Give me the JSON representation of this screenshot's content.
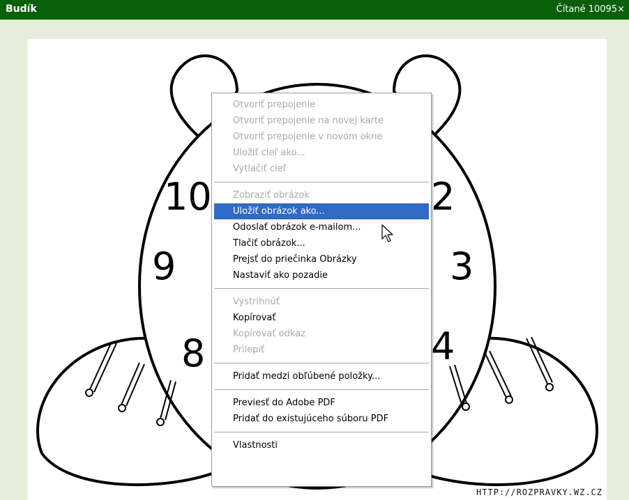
{
  "header": {
    "title": "Budík",
    "read_count": "Čítané 10095×"
  },
  "image": {
    "clock_numbers": [
      "10",
      "2",
      "9",
      "3",
      "8",
      "4"
    ],
    "watermark": "HTTP://ROZPRAVKY.WZ.CZ"
  },
  "context_menu": {
    "group1": [
      {
        "label": "Otvoriť prepojenie",
        "enabled": false
      },
      {
        "label": "Otvoriť prepojenie na novej karte",
        "enabled": false
      },
      {
        "label": "Otvoriť prepojenie v novom okne",
        "enabled": false
      },
      {
        "label": "Uložiť cieľ ako...",
        "enabled": false
      },
      {
        "label": "Vytlačiť cieľ",
        "enabled": false
      }
    ],
    "group2": [
      {
        "label": "Zobraziť obrázok",
        "enabled": false
      },
      {
        "label": "Uložiť obrázok ako...",
        "enabled": true,
        "highlighted": true
      },
      {
        "label": "Odoslať obrázok e-mailom...",
        "enabled": true
      },
      {
        "label": "Tlačiť obrázok...",
        "enabled": true
      },
      {
        "label": "Prejsť do priečinka Obrázky",
        "enabled": true
      },
      {
        "label": "Nastaviť ako pozadie",
        "enabled": true
      }
    ],
    "group3": [
      {
        "label": "Vystrihnúť",
        "enabled": false
      },
      {
        "label": "Kopírovať",
        "enabled": true
      },
      {
        "label": "Kopírovať odkaz",
        "enabled": false
      },
      {
        "label": "Prilepiť",
        "enabled": false
      }
    ],
    "group4": [
      {
        "label": "Pridať medzi obľúbené položky...",
        "enabled": true
      }
    ],
    "group5": [
      {
        "label": "Previesť do Adobe PDF",
        "enabled": true
      },
      {
        "label": "Pridať do existujúceho súboru PDF",
        "enabled": true
      }
    ],
    "group6": [
      {
        "label": "Vlastnosti",
        "enabled": true
      }
    ],
    "highlight_color": "#316ac5"
  },
  "colors": {
    "titlebar": "#0a5f0a",
    "page_background": "#e6eedb"
  },
  "icons": {
    "cursor": "arrow-cursor-icon"
  }
}
